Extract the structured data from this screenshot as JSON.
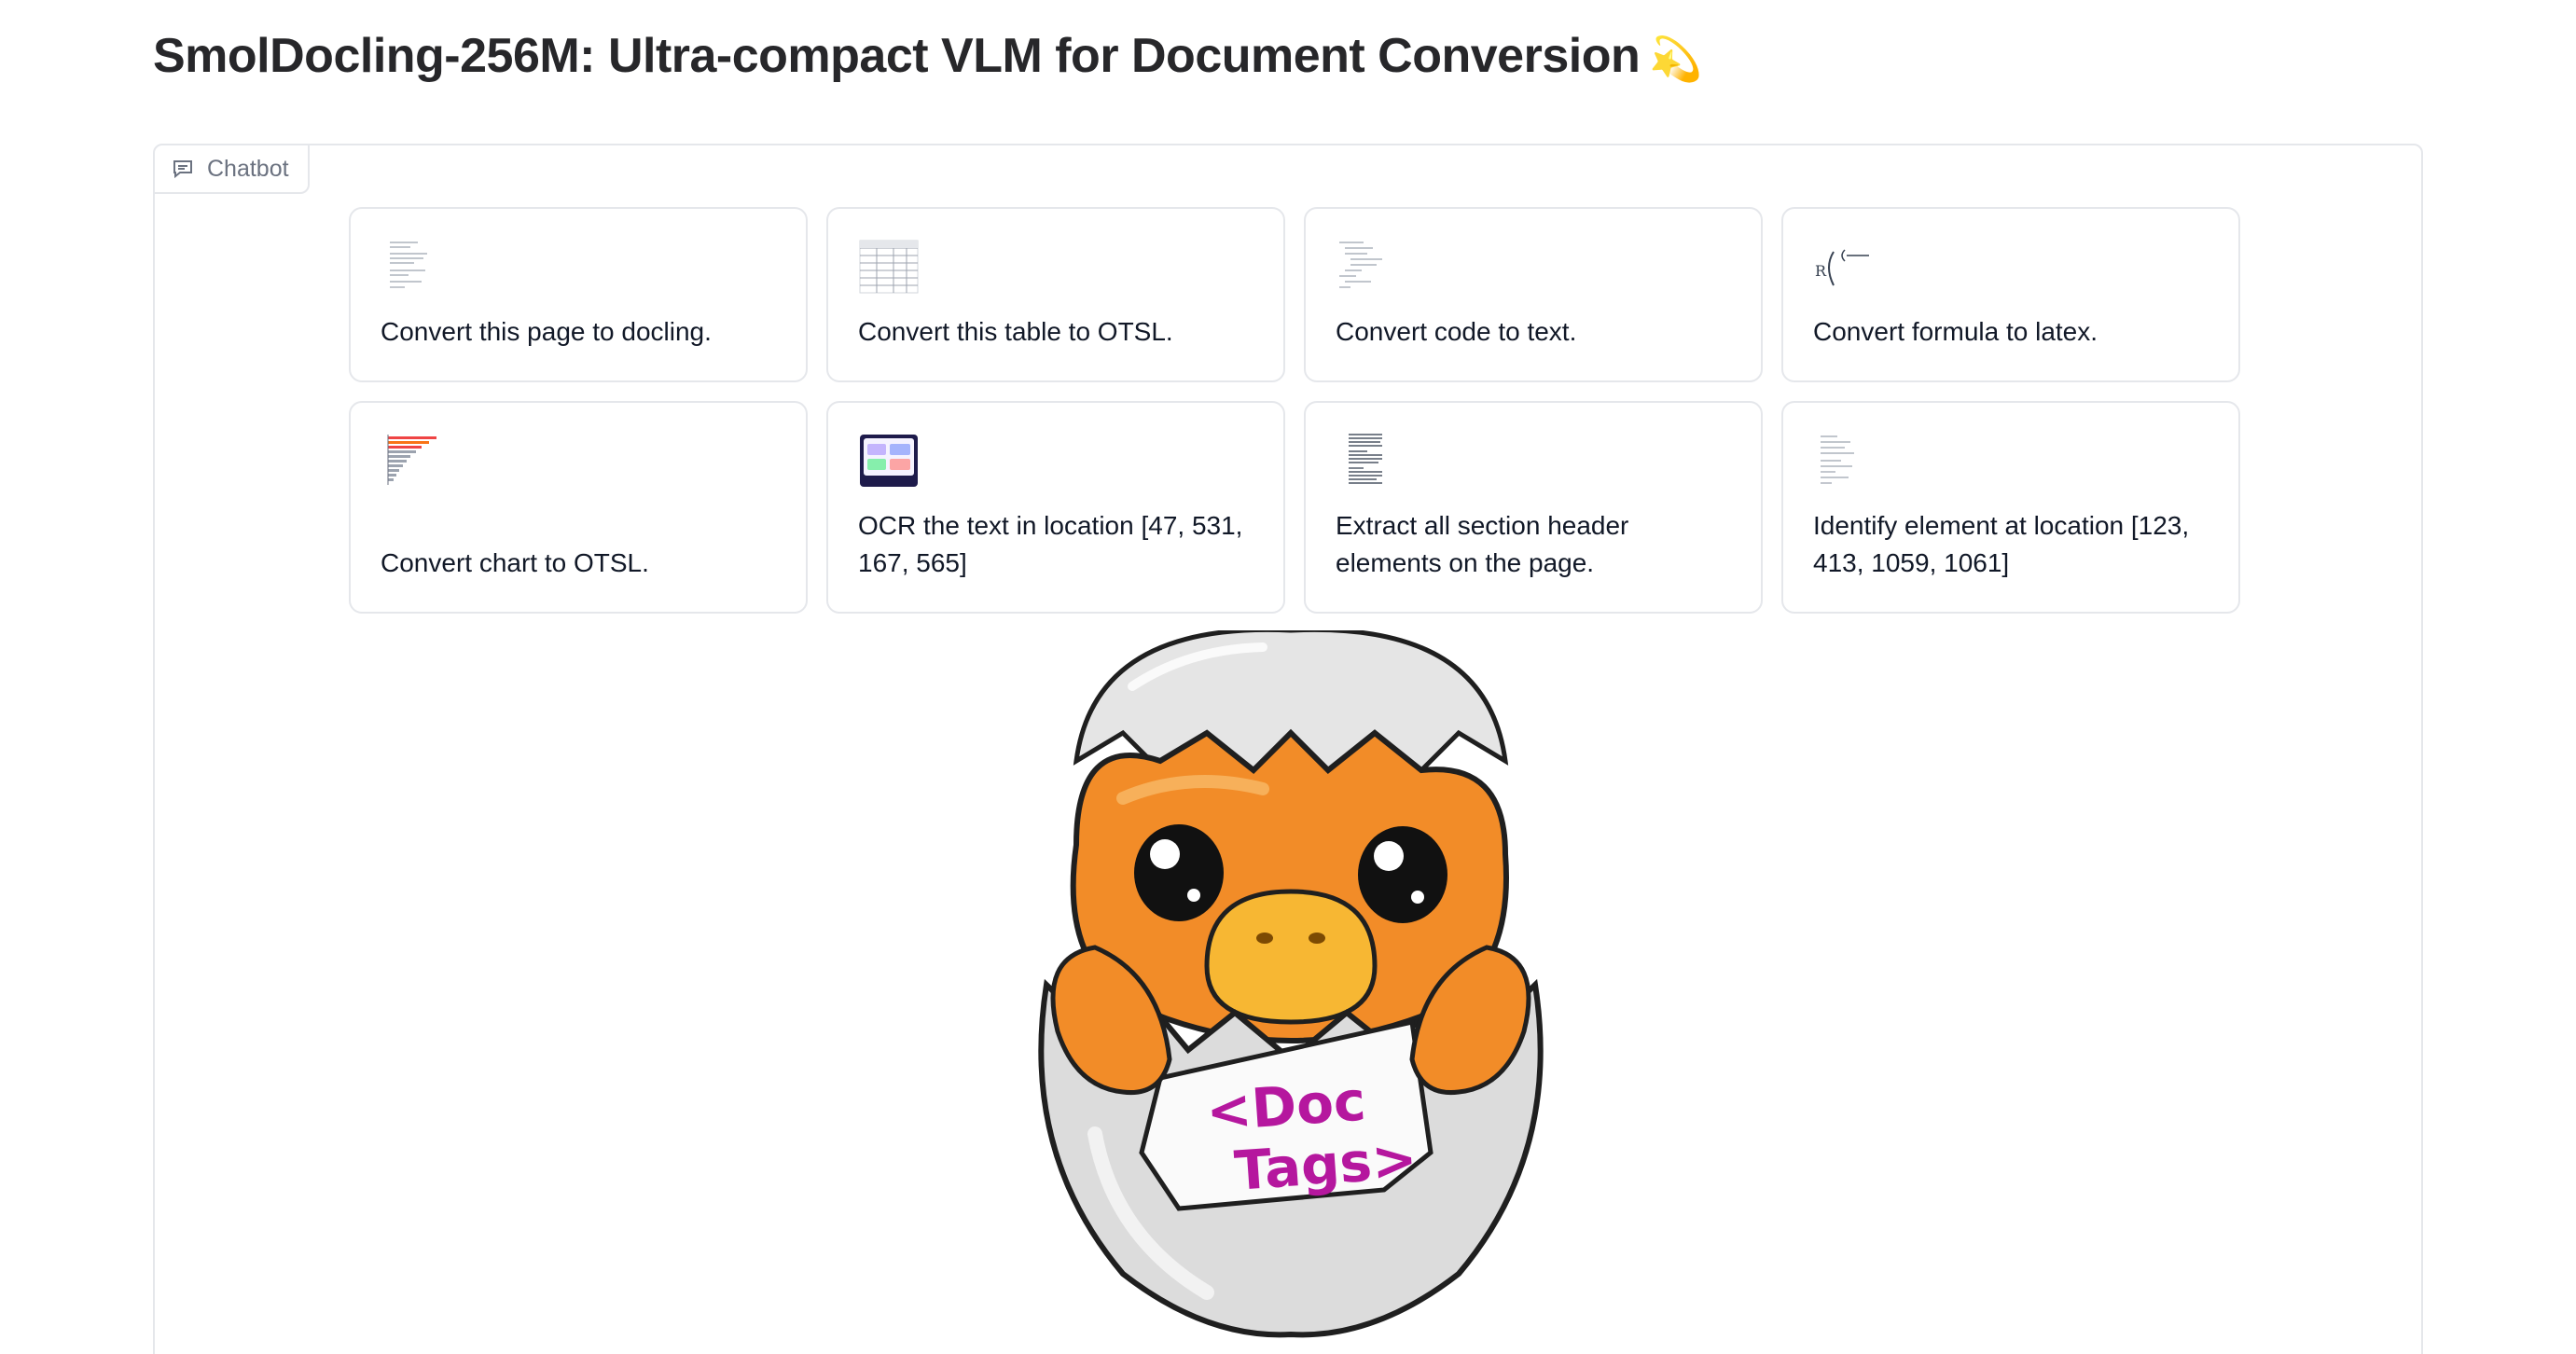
{
  "page": {
    "title": "SmolDocling-256M: Ultra-compact VLM for Document Conversion",
    "title_icon": "💫"
  },
  "chatbot": {
    "label": "Chatbot",
    "icon": "chat-bubble-icon"
  },
  "examples": [
    {
      "text": "Convert this page to docling.",
      "thumbnail": "document-page-thumbnail"
    },
    {
      "text": "Convert this table to OTSL.",
      "thumbnail": "table-thumbnail"
    },
    {
      "text": "Convert code to text.",
      "thumbnail": "code-thumbnail"
    },
    {
      "text": "Convert formula to latex.",
      "thumbnail": "formula-thumbnail"
    },
    {
      "text": "Convert chart to OTSL.",
      "thumbnail": "chart-thumbnail"
    },
    {
      "text": "OCR the text in location [47, 531, 167, 565]",
      "thumbnail": "ui-screenshot-thumbnail"
    },
    {
      "text": "Extract all section header elements on the page.",
      "thumbnail": "text-page-thumbnail"
    },
    {
      "text": "Identify element at location [123, 413, 1059, 1061]",
      "thumbnail": "sparse-page-thumbnail"
    }
  ],
  "mascot": {
    "sheet_text": "<Doc Tags>",
    "colors": {
      "body": "#f28c28",
      "shell": "#d9d9d9",
      "beak": "#f7b733",
      "text": "#b5179e"
    }
  }
}
